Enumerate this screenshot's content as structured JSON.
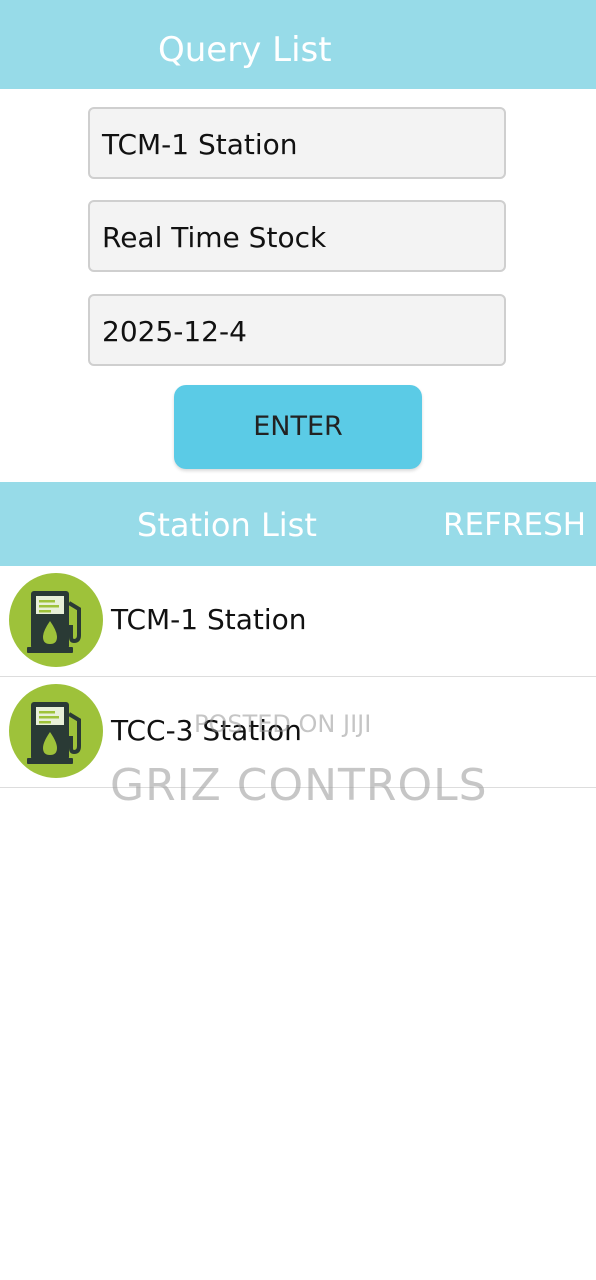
{
  "header": {
    "title": "Query List"
  },
  "query_form": {
    "station_value": "TCM-1 Station",
    "report_type_value": "Real Time Stock",
    "date_value": "2025-12-4",
    "enter_label": "ENTER"
  },
  "station_list": {
    "title": "Station List",
    "refresh_label": "REFRESH",
    "items": [
      {
        "label": "TCM-1 Station",
        "icon": "fuel-pump-icon"
      },
      {
        "label": "TCC-3 Station",
        "icon": "fuel-pump-icon"
      }
    ]
  },
  "watermark": {
    "posted_text": "POSTED ON JIJI",
    "brand_text": "GRIZ CONTROLS"
  },
  "colors": {
    "header_bg": "#97dbe8",
    "enter_button": "#5bcbe6",
    "icon_circle": "#9ec23a",
    "icon_pump": "#2a3a35"
  }
}
